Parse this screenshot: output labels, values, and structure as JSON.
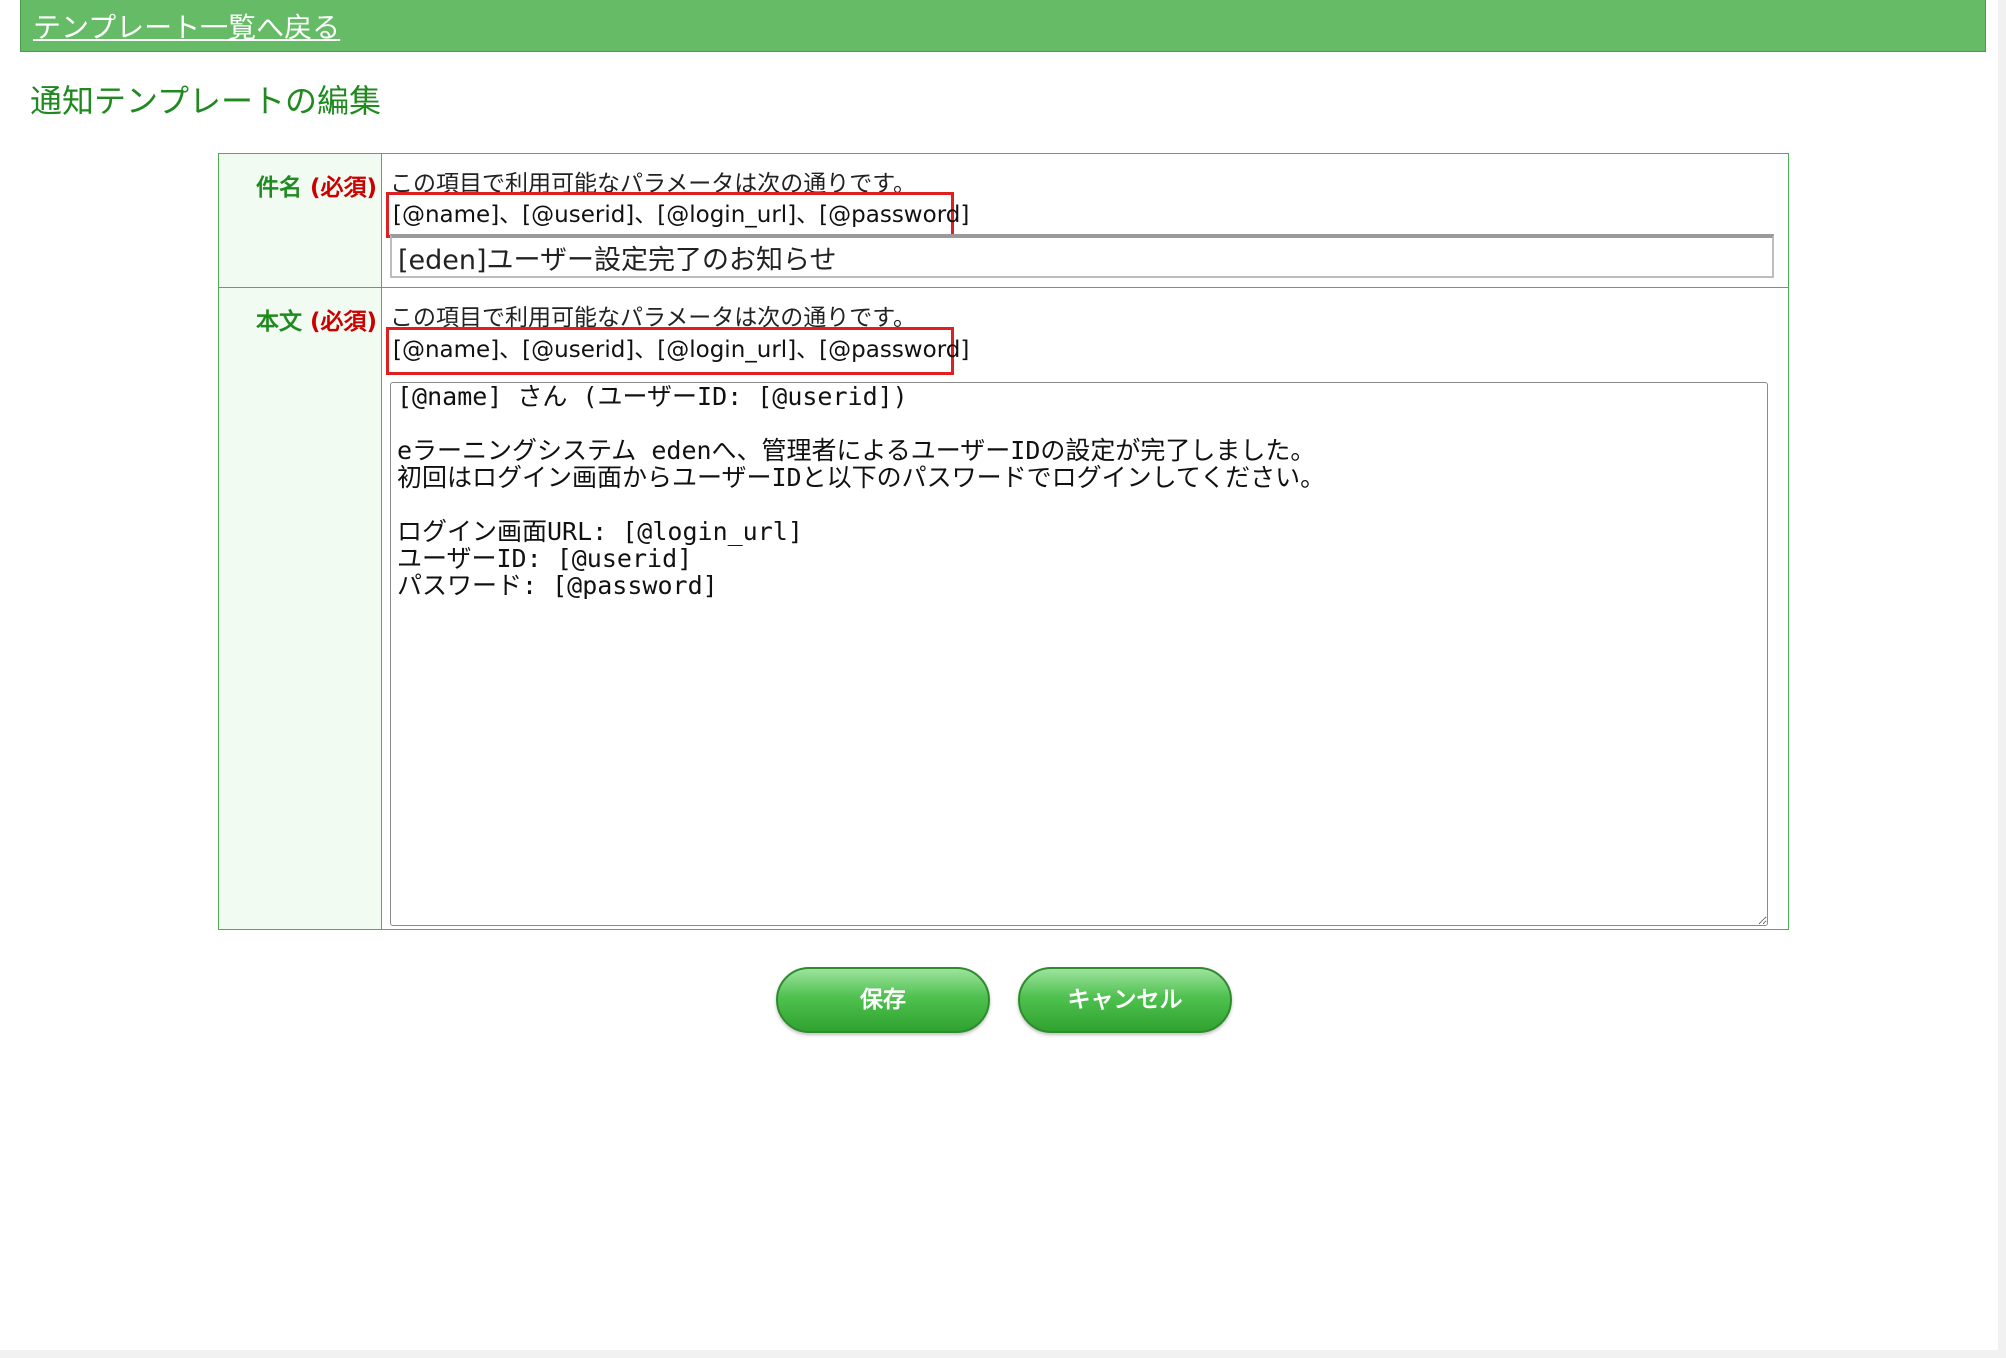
{
  "header": {
    "back_link": "テンプレート一覧へ戻る"
  },
  "page": {
    "title": "通知テンプレートの編集"
  },
  "form": {
    "subject": {
      "label": "件名",
      "required": "(必須)",
      "note": "この項目で利用可能なパラメータは次の通りです。",
      "params": "[@name]、[@userid]、[@login_url]、[@password]",
      "value": "[eden]ユーザー設定完了のお知らせ"
    },
    "body": {
      "label": "本文",
      "required": "(必須)",
      "note": "この項目で利用可能なパラメータは次の通りです。",
      "params": "[@name]、[@userid]、[@login_url]、[@password]",
      "value": "[@name] さん (ユーザーID: [@userid])\n\neラーニングシステム edenへ、管理者によるユーザーIDの設定が完了しました。\n初回はログイン画面からユーザーIDと以下のパスワードでログインしてください。\n\nログイン画面URL: [@login_url]\nユーザーID: [@userid]\nパスワード: [@password]"
    }
  },
  "actions": {
    "save_label": "保存",
    "cancel_label": "キャンセル"
  },
  "colors": {
    "header_bg": "#66bb66",
    "title_green": "#1f8a1f",
    "required_red": "#cc0000",
    "highlight_red": "#e02020"
  }
}
